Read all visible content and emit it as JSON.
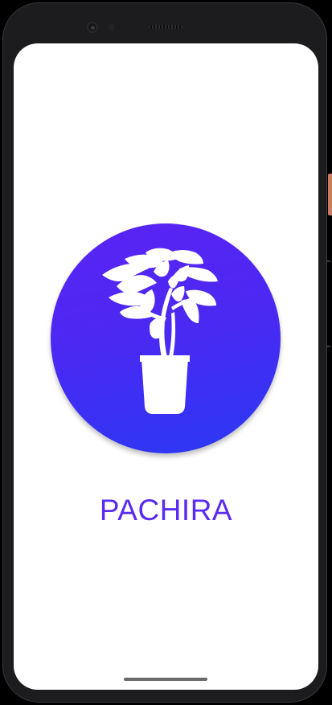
{
  "app": {
    "name": "PACHIRA"
  },
  "logo": {
    "icon": "potted-plant-icon",
    "gradient_top": "#5a23f4",
    "gradient_bottom": "#2a39f5"
  },
  "colors": {
    "brand_text": "#5a2bf0",
    "screen_background": "#ffffff",
    "device_frame": "#1c1c1e"
  }
}
